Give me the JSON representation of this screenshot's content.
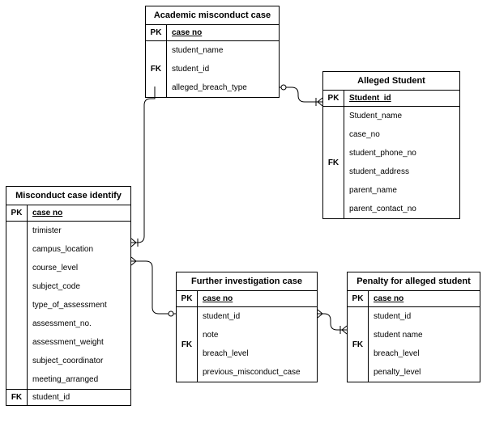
{
  "entities": {
    "academic": {
      "title": "Academic misconduct case",
      "pk": "case no",
      "fk_marker": "FK",
      "attrs": [
        "student_name",
        "student_id",
        "alleged_breach_type"
      ]
    },
    "alleged": {
      "title": "Alleged Student",
      "pk": "Student_id",
      "fk_marker": "FK",
      "attrs": [
        "Student_name",
        "case_no",
        "student_phone_no",
        "student_address",
        "parent_name",
        "parent_contact_no"
      ]
    },
    "identify": {
      "title": "Misconduct case identify",
      "pk": "case no",
      "fk_marker": "FK",
      "attrs": [
        "trimister",
        "campus_location",
        "course_level",
        "subject_code",
        "type_of_assessment",
        "assessment_no.",
        "assessment_weight",
        "subject_coordinator",
        "meeting_arranged",
        "student_id"
      ]
    },
    "investigation": {
      "title": "Further investigation case",
      "pk": "case no",
      "fk_marker": "FK",
      "attrs": [
        "student_id",
        "note",
        "breach_level",
        "previous_misconduct_case"
      ]
    },
    "penalty": {
      "title": "Penalty for alleged student",
      "pk": "case no",
      "fk_marker": "FK",
      "attrs": [
        "student_id",
        "student name",
        "breach_level",
        "penalty_level"
      ]
    }
  },
  "labels": {
    "pk": "PK"
  }
}
